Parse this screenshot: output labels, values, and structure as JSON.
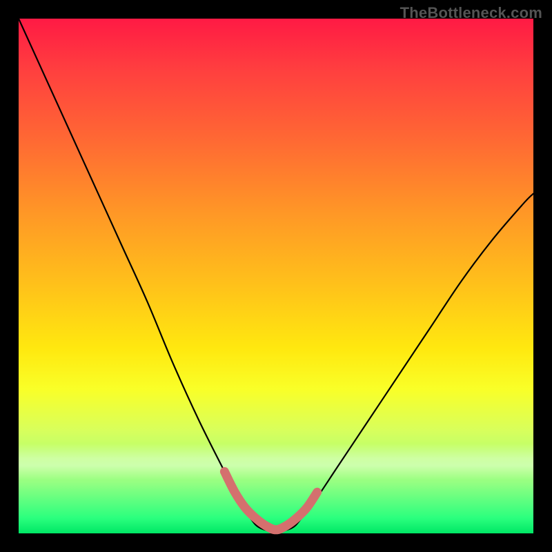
{
  "watermark": "TheBottleneck.com",
  "chart_data": {
    "type": "line",
    "title": "",
    "xlabel": "",
    "ylabel": "",
    "xlim": [
      0,
      100
    ],
    "ylim": [
      0,
      100
    ],
    "grid": false,
    "legend": false,
    "series": [
      {
        "name": "bottleneck-curve",
        "color": "#000000",
        "x": [
          0,
          5,
          10,
          15,
          20,
          25,
          30,
          35,
          40,
          42,
          45,
          47,
          50,
          53,
          55,
          58,
          62,
          68,
          74,
          80,
          86,
          92,
          98,
          100
        ],
        "values": [
          100,
          89,
          78,
          67,
          56,
          45,
          33,
          22,
          12,
          8,
          3,
          1,
          0.5,
          1,
          3,
          7,
          13,
          22,
          31,
          40,
          49,
          57,
          64,
          66
        ]
      },
      {
        "name": "minimum-highlight",
        "color": "#d4706e",
        "x": [
          40,
          42,
          44,
          46,
          48,
          50,
          52,
          54,
          56,
          58
        ],
        "values": [
          12,
          8,
          5,
          3,
          1.5,
          0.7,
          1.5,
          3,
          5,
          8
        ]
      }
    ],
    "background_gradient": {
      "top": "#ff1a44",
      "middle": "#ffe80f",
      "bottom": "#00e765"
    }
  }
}
